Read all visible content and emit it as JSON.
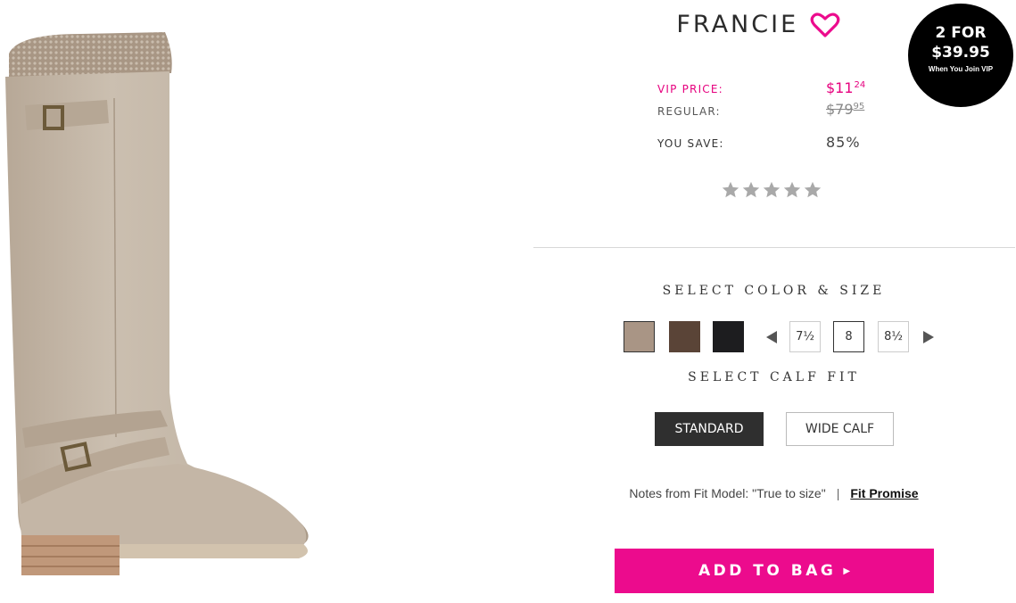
{
  "product": {
    "title": "FRANCIE",
    "image_alt": "tall taupe riding boot with knit cuff and buckle straps"
  },
  "promo": {
    "line1": "2 FOR",
    "line2": "$39.95",
    "line3": "When You Join VIP"
  },
  "pricing": {
    "vip_label": "VIP PRICE:",
    "vip_dollars": "$11",
    "vip_cents": "24",
    "regular_label": "REGULAR:",
    "regular_dollars": "$79",
    "regular_cents": "95",
    "save_label": "YOU SAVE:",
    "save_value": "85%"
  },
  "rating": {
    "stars_filled": 0,
    "stars_total": 5
  },
  "selection": {
    "heading": "SELECT COLOR & SIZE",
    "colors": [
      {
        "name": "taupe",
        "hex": "#a99585",
        "selected": true
      },
      {
        "name": "brown",
        "hex": "#5a4437",
        "selected": false
      },
      {
        "name": "black",
        "hex": "#1d1d1f",
        "selected": false
      }
    ],
    "sizes": [
      {
        "label": "7½",
        "selected": false
      },
      {
        "label": "8",
        "selected": true
      },
      {
        "label": "8½",
        "selected": false
      }
    ]
  },
  "calf_fit": {
    "heading": "SELECT CALF FIT",
    "options": [
      {
        "label": "STANDARD",
        "selected": true
      },
      {
        "label": "WIDE CALF",
        "selected": false
      }
    ]
  },
  "fit_notes": {
    "text": "Notes from Fit Model: \"True to size\"",
    "separator": "|",
    "link": "Fit Promise"
  },
  "cta": {
    "label": "ADD TO BAG"
  },
  "colors": {
    "brand_pink": "#ec0b8d",
    "vip_pink": "#e6007e",
    "dark_button": "#2f2f2f"
  }
}
